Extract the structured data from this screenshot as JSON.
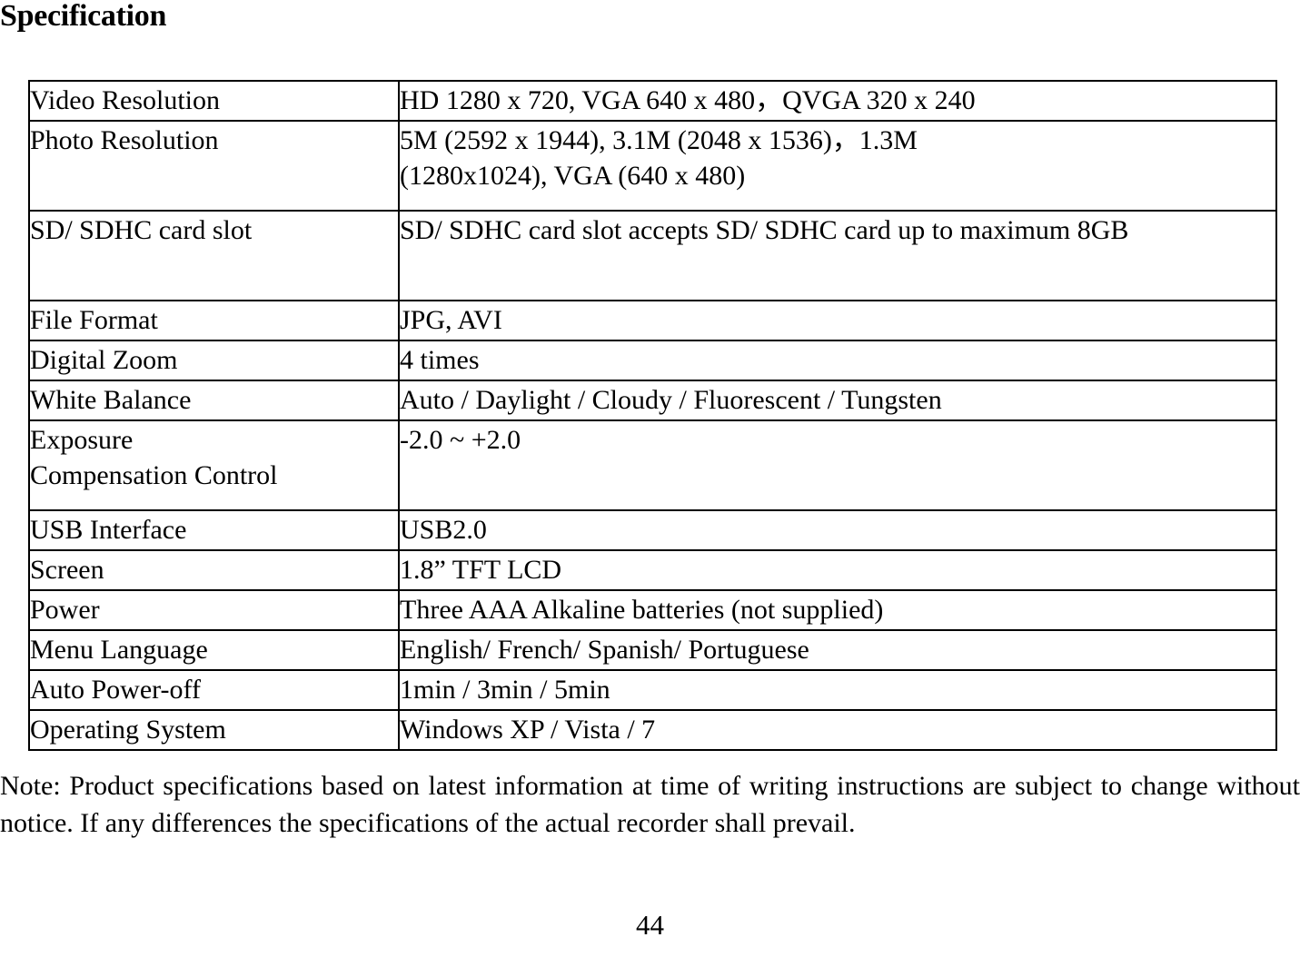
{
  "document": {
    "heading": "Specification",
    "page_number": "44"
  },
  "spec_table": {
    "rows": [
      {
        "label": "Video Resolution",
        "value": "HD 1280 x 720, VGA 640 x 480，QVGA 320 x 240",
        "value_lines": [
          "HD 1280 x 720, VGA 640 x 480，QVGA 320 x 240"
        ],
        "justified": false
      },
      {
        "label": "Photo Resolution",
        "value": "5M (2592 x 1944), 3.1M (2048 x 1536)，1.3M (1280x1024), VGA (640 x 480)",
        "value_lines": [
          "5M (2592 x 1944), 3.1M (2048 x 1536)，1.3M",
          "(1280x1024), VGA (640 x 480)"
        ],
        "justified": false
      },
      {
        "label": "SD/ SDHC card slot",
        "value": "SD/ SDHC card slot accepts SD/ SDHC card up to maximum 8GB",
        "value_lines": [
          "SD/ SDHC card slot accepts SD/ SDHC card up to maximum 8GB"
        ],
        "justified": true
      },
      {
        "label": "File Format",
        "value": "JPG, AVI",
        "value_lines": [
          "JPG, AVI"
        ],
        "justified": false
      },
      {
        "label": "Digital Zoom",
        "value": "4 times",
        "value_lines": [
          "4 times"
        ],
        "justified": false
      },
      {
        "label": "White Balance",
        "value": "Auto / Daylight / Cloudy / Fluorescent / Tungsten",
        "value_lines": [
          "Auto / Daylight / Cloudy / Fluorescent / Tungsten"
        ],
        "justified": false
      },
      {
        "label": "Exposure Compensation Control",
        "label_lines": [
          "Exposure",
          "Compensation Control"
        ],
        "value": "-2.0 ~ +2.0",
        "value_lines": [
          "-2.0 ~ +2.0"
        ],
        "justified": false
      },
      {
        "label": "USB Interface",
        "value": "USB2.0",
        "value_lines": [
          "USB2.0"
        ],
        "justified": false
      },
      {
        "label": "Screen",
        "value": "1.8” TFT LCD",
        "value_lines": [
          "1.8” TFT LCD"
        ],
        "justified": false
      },
      {
        "label": "Power",
        "value": "Three AAA Alkaline batteries (not supplied)",
        "value_lines": [
          "Three AAA Alkaline batteries (not supplied)"
        ],
        "justified": false
      },
      {
        "label": "Menu Language",
        "value": "English/ French/ Spanish/ Portuguese",
        "value_lines": [
          "English/ French/ Spanish/ Portuguese"
        ],
        "justified": false
      },
      {
        "label": "Auto Power-off",
        "value": "1min / 3min / 5min",
        "value_lines": [
          "1min / 3min / 5min"
        ],
        "justified": false
      },
      {
        "label": "Operating System",
        "value": "Windows XP / Vista / 7",
        "value_lines": [
          "Windows XP / Vista / 7"
        ],
        "justified": false
      }
    ]
  },
  "note": {
    "text": "Note: Product specifications based on latest information at time of writing instructions are subject to change without notice. If any differences the specifications of the actual recorder shall prevail."
  }
}
